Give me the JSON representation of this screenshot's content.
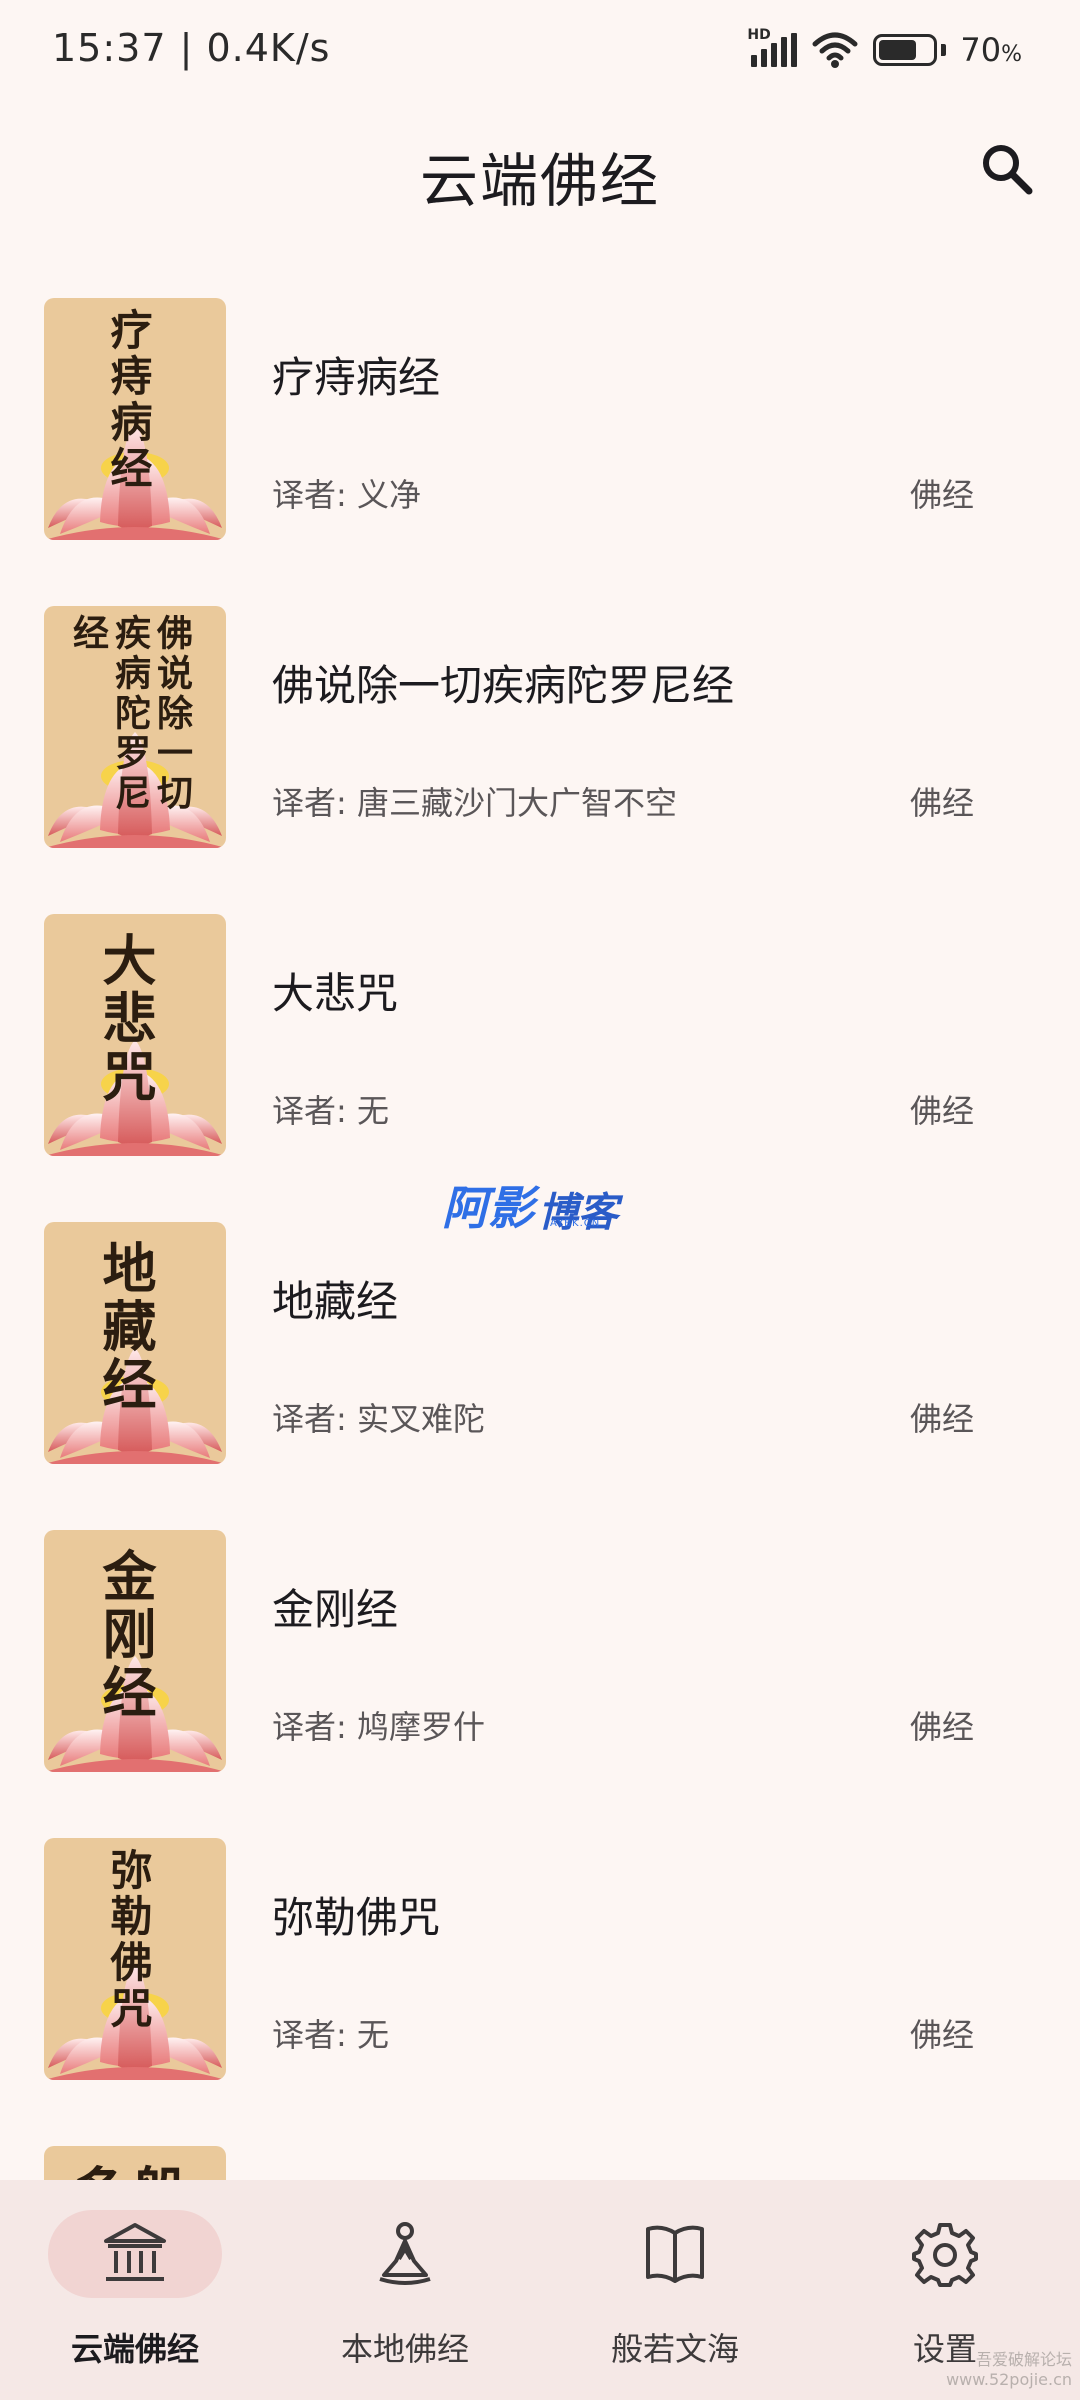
{
  "status_bar": {
    "time": "15:37 | 0.4K/s",
    "network_badge": "HD",
    "battery_level": 70,
    "battery_value": "70",
    "battery_unit": "%",
    "icons": [
      "signal-icon",
      "wifi-icon",
      "battery-icon"
    ]
  },
  "header": {
    "title": "云端佛经",
    "search_icon": "search-icon"
  },
  "list": {
    "translator_prefix": "译者: ",
    "items": [
      {
        "title": "疗痔病经",
        "translator": "译者: 义净",
        "category": "佛经",
        "cover_cols": [
          "疗痔病经"
        ]
      },
      {
        "title": "佛说除一切疾病陀罗尼经",
        "translator": "译者: 唐三藏沙门大广智不空",
        "category": "佛经",
        "cover_cols": [
          "佛说除一切",
          "疾病陀罗尼",
          "经"
        ]
      },
      {
        "title": "大悲咒",
        "translator": "译者: 无",
        "category": "佛经",
        "cover_cols": [
          "大悲咒"
        ]
      },
      {
        "title": "地藏经",
        "translator": "译者: 实叉难陀",
        "category": "佛经",
        "cover_cols": [
          "地藏经"
        ]
      },
      {
        "title": "金刚经",
        "translator": "译者: 鸠摩罗什",
        "category": "佛经",
        "cover_cols": [
          "金刚经"
        ]
      },
      {
        "title": "弥勒佛咒",
        "translator": "译者: 无",
        "category": "佛经",
        "cover_cols": [
          "弥勒佛咒"
        ]
      },
      {
        "title": "",
        "translator": "",
        "category": "",
        "cover_cols": [
          "般",
          "多"
        ]
      }
    ]
  },
  "watermark": {
    "part1": "阿影",
    "part2": "博客",
    "sub": "AYBK.CN"
  },
  "bottom_nav": {
    "items": [
      {
        "label": "云端佛经",
        "icon": "temple-icon",
        "active": true
      },
      {
        "label": "本地佛经",
        "icon": "meditating-person-icon",
        "active": false
      },
      {
        "label": "般若文海",
        "icon": "open-book-icon",
        "active": false
      },
      {
        "label": "设置",
        "icon": "gear-icon",
        "active": false
      }
    ]
  },
  "corner_watermark": {
    "line1": "吾爱破解论坛",
    "line2": "www.52pojie.cn"
  },
  "colors": {
    "background": "#fdf6f3",
    "cover": "#eac99b",
    "nav_background": "#f5e8e6",
    "nav_active_pill": "#f1d4d2",
    "watermark_blue": "#2f6fe6"
  }
}
